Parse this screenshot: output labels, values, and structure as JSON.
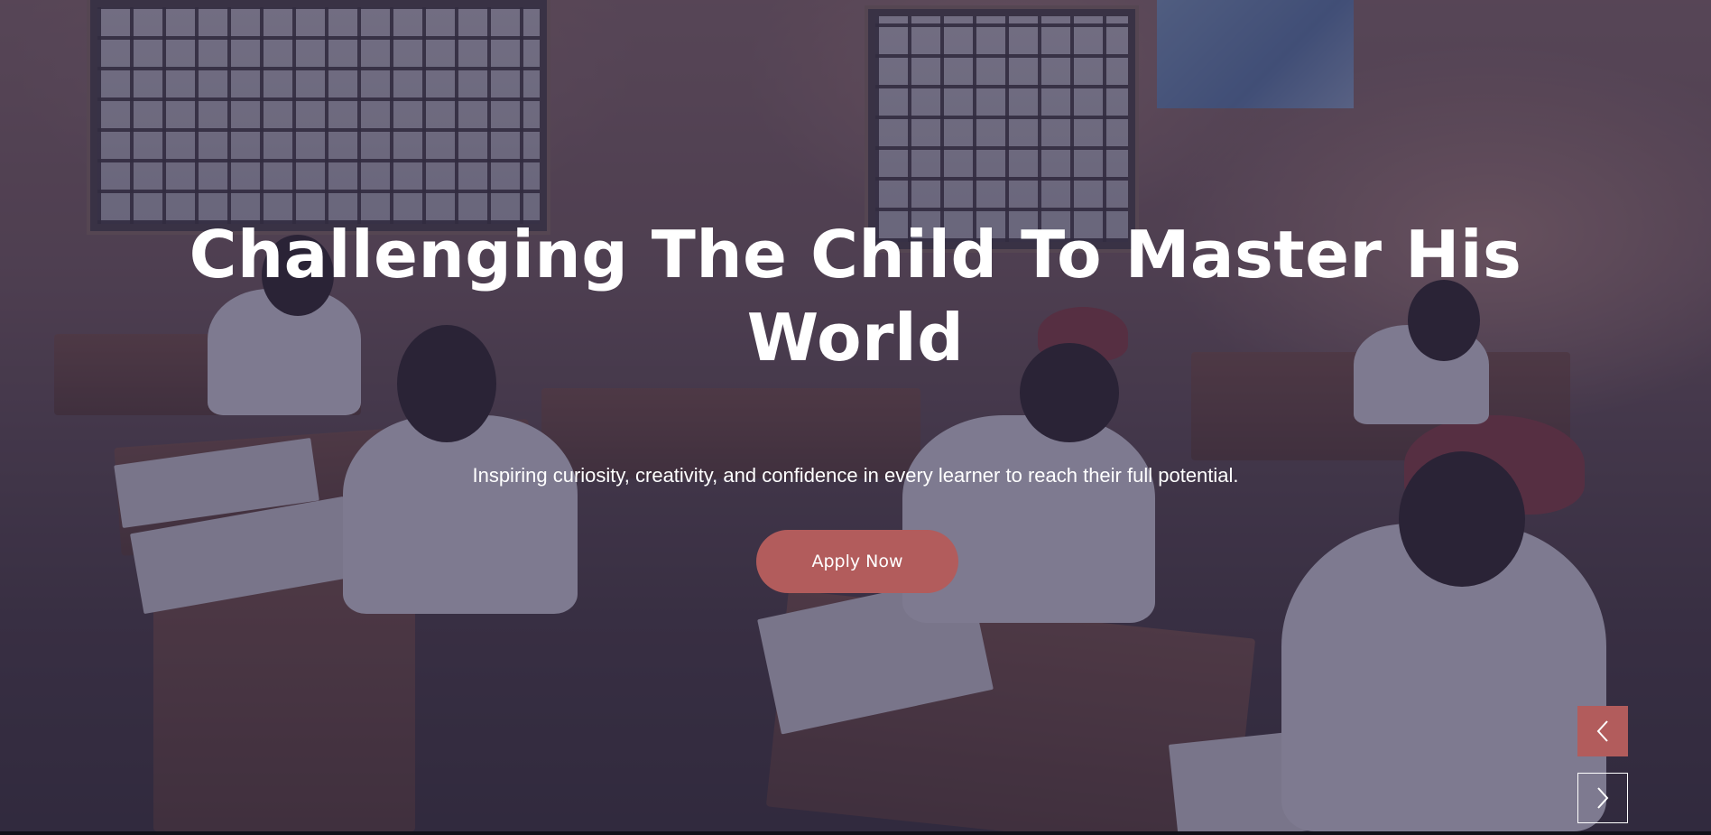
{
  "hero": {
    "headline": "Challenging The Child To Master His World",
    "subheadline": "Inspiring curiosity, creativity, and confidence in every learner to reach their full potential.",
    "cta_label": "Apply Now"
  },
  "carousel": {
    "prev_icon": "chevron-left-icon",
    "next_icon": "chevron-right-icon"
  },
  "colors": {
    "accent": "#b25c5c",
    "overlay": "rgba(42,38,70,0.55)",
    "text": "#ffffff"
  }
}
